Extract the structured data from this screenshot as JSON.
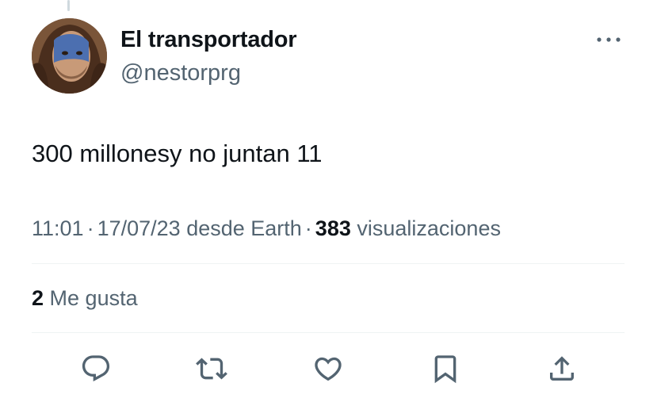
{
  "tweet": {
    "author_name": "El transportador",
    "author_handle": "@nestorprg",
    "text": "300 millonesy no juntan 11",
    "time": "11:01",
    "date": "17/07/23",
    "source": "desde Earth",
    "separator": "·",
    "views_count": "383",
    "views_label": "visualizaciones",
    "likes_count": "2",
    "likes_label": "Me gusta"
  },
  "actions": [
    {
      "name": "reply",
      "icon": "reply-icon"
    },
    {
      "name": "retweet",
      "icon": "retweet-icon"
    },
    {
      "name": "like",
      "icon": "heart-icon"
    },
    {
      "name": "bookmark",
      "icon": "bookmark-icon"
    },
    {
      "name": "share",
      "icon": "share-icon"
    }
  ],
  "colors": {
    "text_primary": "#0f1419",
    "text_secondary": "#536471",
    "divider": "#eff3f4",
    "icon": "#536471"
  }
}
